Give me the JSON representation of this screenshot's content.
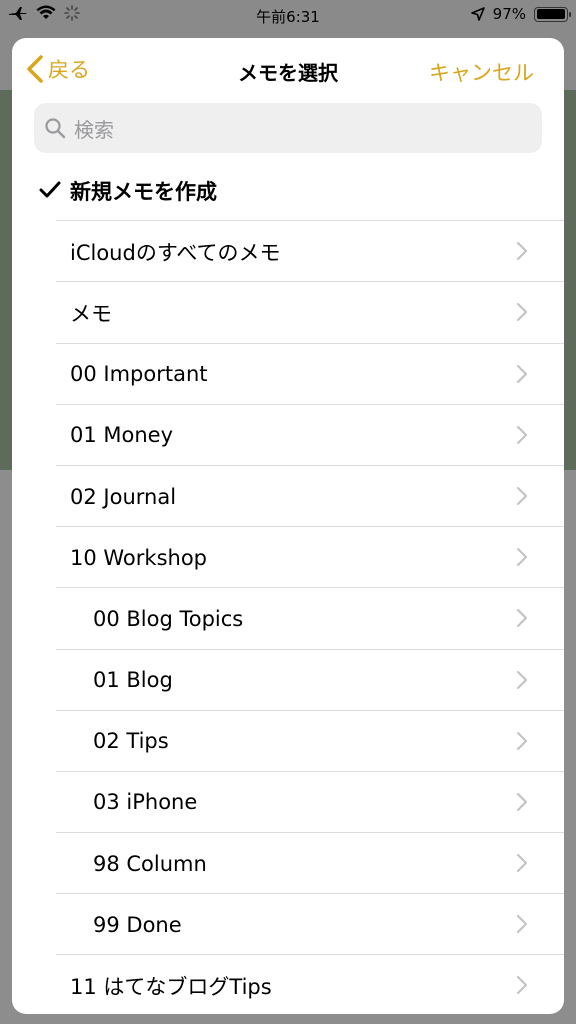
{
  "status": {
    "time": "午前6:31",
    "battery": "97%",
    "battery_level": 0.97
  },
  "nav": {
    "back_label": "戻る",
    "title": "メモを選択",
    "cancel_label": "キャンセル"
  },
  "search": {
    "placeholder": "検索"
  },
  "items": [
    {
      "label": "新規メモを作成",
      "checked": true,
      "indent": 0,
      "chevron": false
    },
    {
      "label": "iCloudのすべてのメモ",
      "indent": 0,
      "chevron": true
    },
    {
      "label": "メモ",
      "indent": 0,
      "chevron": true
    },
    {
      "label": "00 Important",
      "indent": 0,
      "chevron": true
    },
    {
      "label": "01 Money",
      "indent": 0,
      "chevron": true
    },
    {
      "label": "02 Journal",
      "indent": 0,
      "chevron": true
    },
    {
      "label": "10 Workshop",
      "indent": 0,
      "chevron": true
    },
    {
      "label": "00 Blog Topics",
      "indent": 1,
      "chevron": true
    },
    {
      "label": "01 Blog",
      "indent": 1,
      "chevron": true
    },
    {
      "label": "02 Tips",
      "indent": 1,
      "chevron": true
    },
    {
      "label": "03 iPhone",
      "indent": 1,
      "chevron": true
    },
    {
      "label": "98 Column",
      "indent": 1,
      "chevron": true
    },
    {
      "label": "99 Done",
      "indent": 1,
      "chevron": true
    },
    {
      "label": "11 はてなブログTips",
      "indent": 0,
      "chevron": true
    }
  ],
  "colors": {
    "accent": "#d9a51b",
    "separator": "#dcdcdf"
  }
}
